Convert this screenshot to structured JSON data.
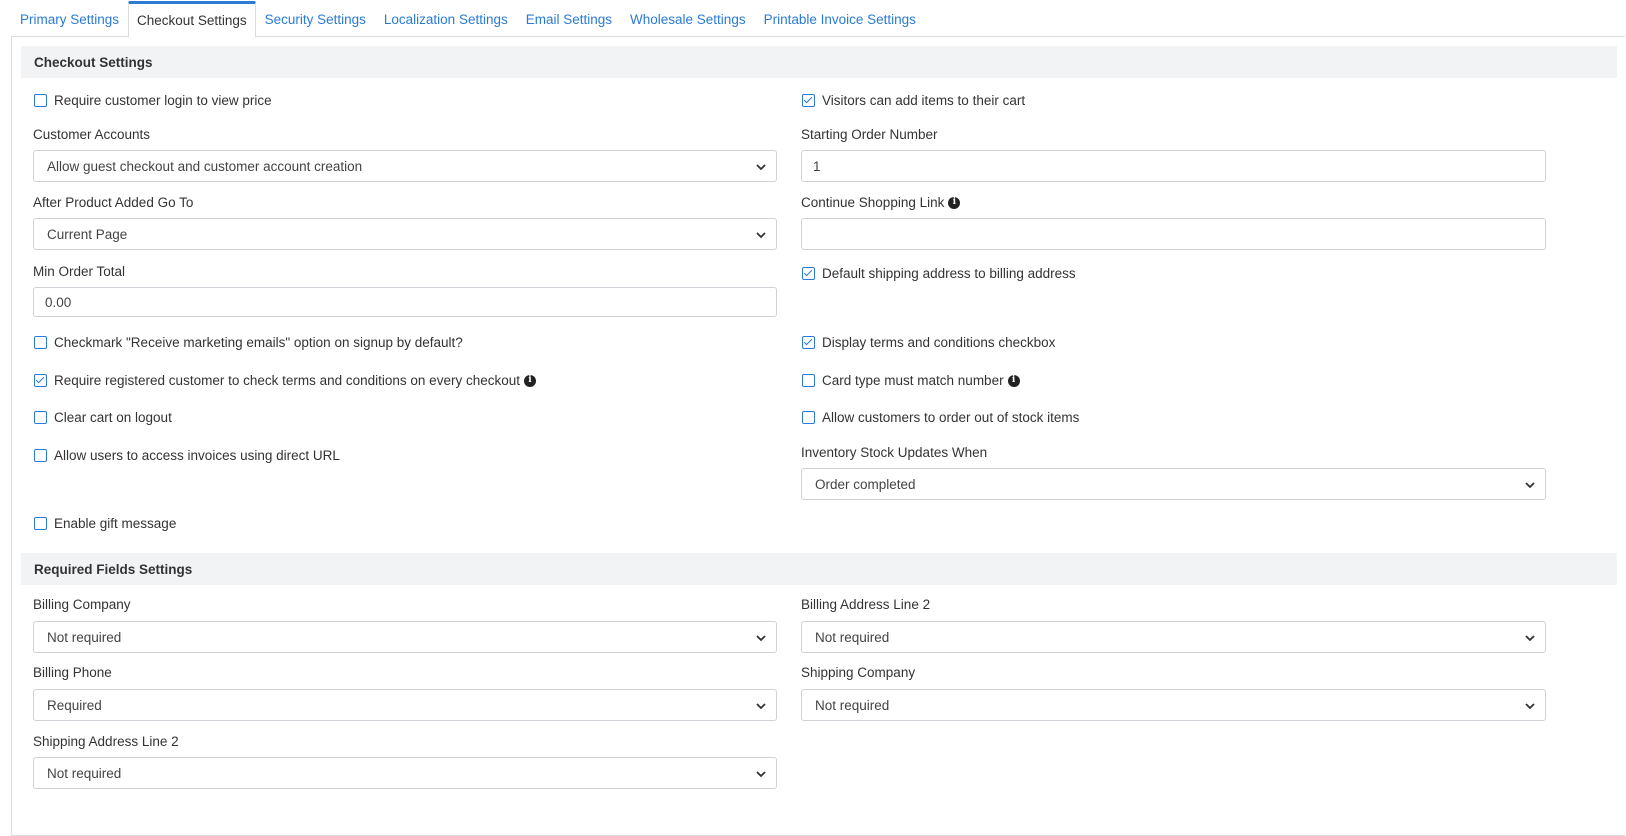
{
  "tabs": [
    {
      "label": "Primary Settings",
      "active": false
    },
    {
      "label": "Checkout Settings",
      "active": true
    },
    {
      "label": "Security Settings",
      "active": false
    },
    {
      "label": "Localization Settings",
      "active": false
    },
    {
      "label": "Email Settings",
      "active": false
    },
    {
      "label": "Wholesale Settings",
      "active": false
    },
    {
      "label": "Printable Invoice Settings",
      "active": false
    }
  ],
  "checkout": {
    "title": "Checkout Settings",
    "require_login_price": {
      "label": "Require customer login to view price",
      "checked": false
    },
    "visitors_add_cart": {
      "label": "Visitors can add items to their cart",
      "checked": true
    },
    "customer_accounts": {
      "label": "Customer Accounts",
      "value": "Allow guest checkout and customer account creation"
    },
    "starting_order_number": {
      "label": "Starting Order Number",
      "value": "1"
    },
    "after_product_added": {
      "label": "After Product Added Go To",
      "value": "Current Page"
    },
    "continue_shopping_link": {
      "label": "Continue Shopping Link",
      "value": ""
    },
    "min_order_total": {
      "label": "Min Order Total",
      "value": "0.00"
    },
    "default_shipping_billing": {
      "label": "Default shipping address to billing address",
      "checked": true
    },
    "marketing_emails": {
      "label": "Checkmark \"Receive marketing emails\" option on signup by default?",
      "checked": false
    },
    "display_terms": {
      "label": "Display terms and conditions checkbox",
      "checked": true
    },
    "require_terms_every": {
      "label": "Require registered customer to check terms and conditions on every checkout",
      "checked": true
    },
    "card_type_match": {
      "label": "Card type must match number",
      "checked": false
    },
    "clear_cart_logout": {
      "label": "Clear cart on logout",
      "checked": false
    },
    "out_of_stock": {
      "label": "Allow customers to order out of stock items",
      "checked": false
    },
    "invoices_direct_url": {
      "label": "Allow users to access invoices using direct URL",
      "checked": false
    },
    "inventory_updates": {
      "label": "Inventory Stock Updates When",
      "value": "Order completed"
    },
    "gift_message": {
      "label": "Enable gift message",
      "checked": false
    }
  },
  "required_fields": {
    "title": "Required Fields Settings",
    "billing_company": {
      "label": "Billing Company",
      "value": "Not required"
    },
    "billing_address_2": {
      "label": "Billing Address Line 2",
      "value": "Not required"
    },
    "billing_phone": {
      "label": "Billing Phone",
      "value": "Required"
    },
    "shipping_company": {
      "label": "Shipping Company",
      "value": "Not required"
    },
    "shipping_address_2": {
      "label": "Shipping Address Line 2",
      "value": "Not required"
    }
  },
  "icons": {
    "info": "info-icon",
    "chevron": "chevron-down-icon",
    "check": "checkbox-icon"
  },
  "colors": {
    "accent": "#2b7bd6",
    "section_bg": "#f2f3f5",
    "border": "#cfd3d8"
  }
}
